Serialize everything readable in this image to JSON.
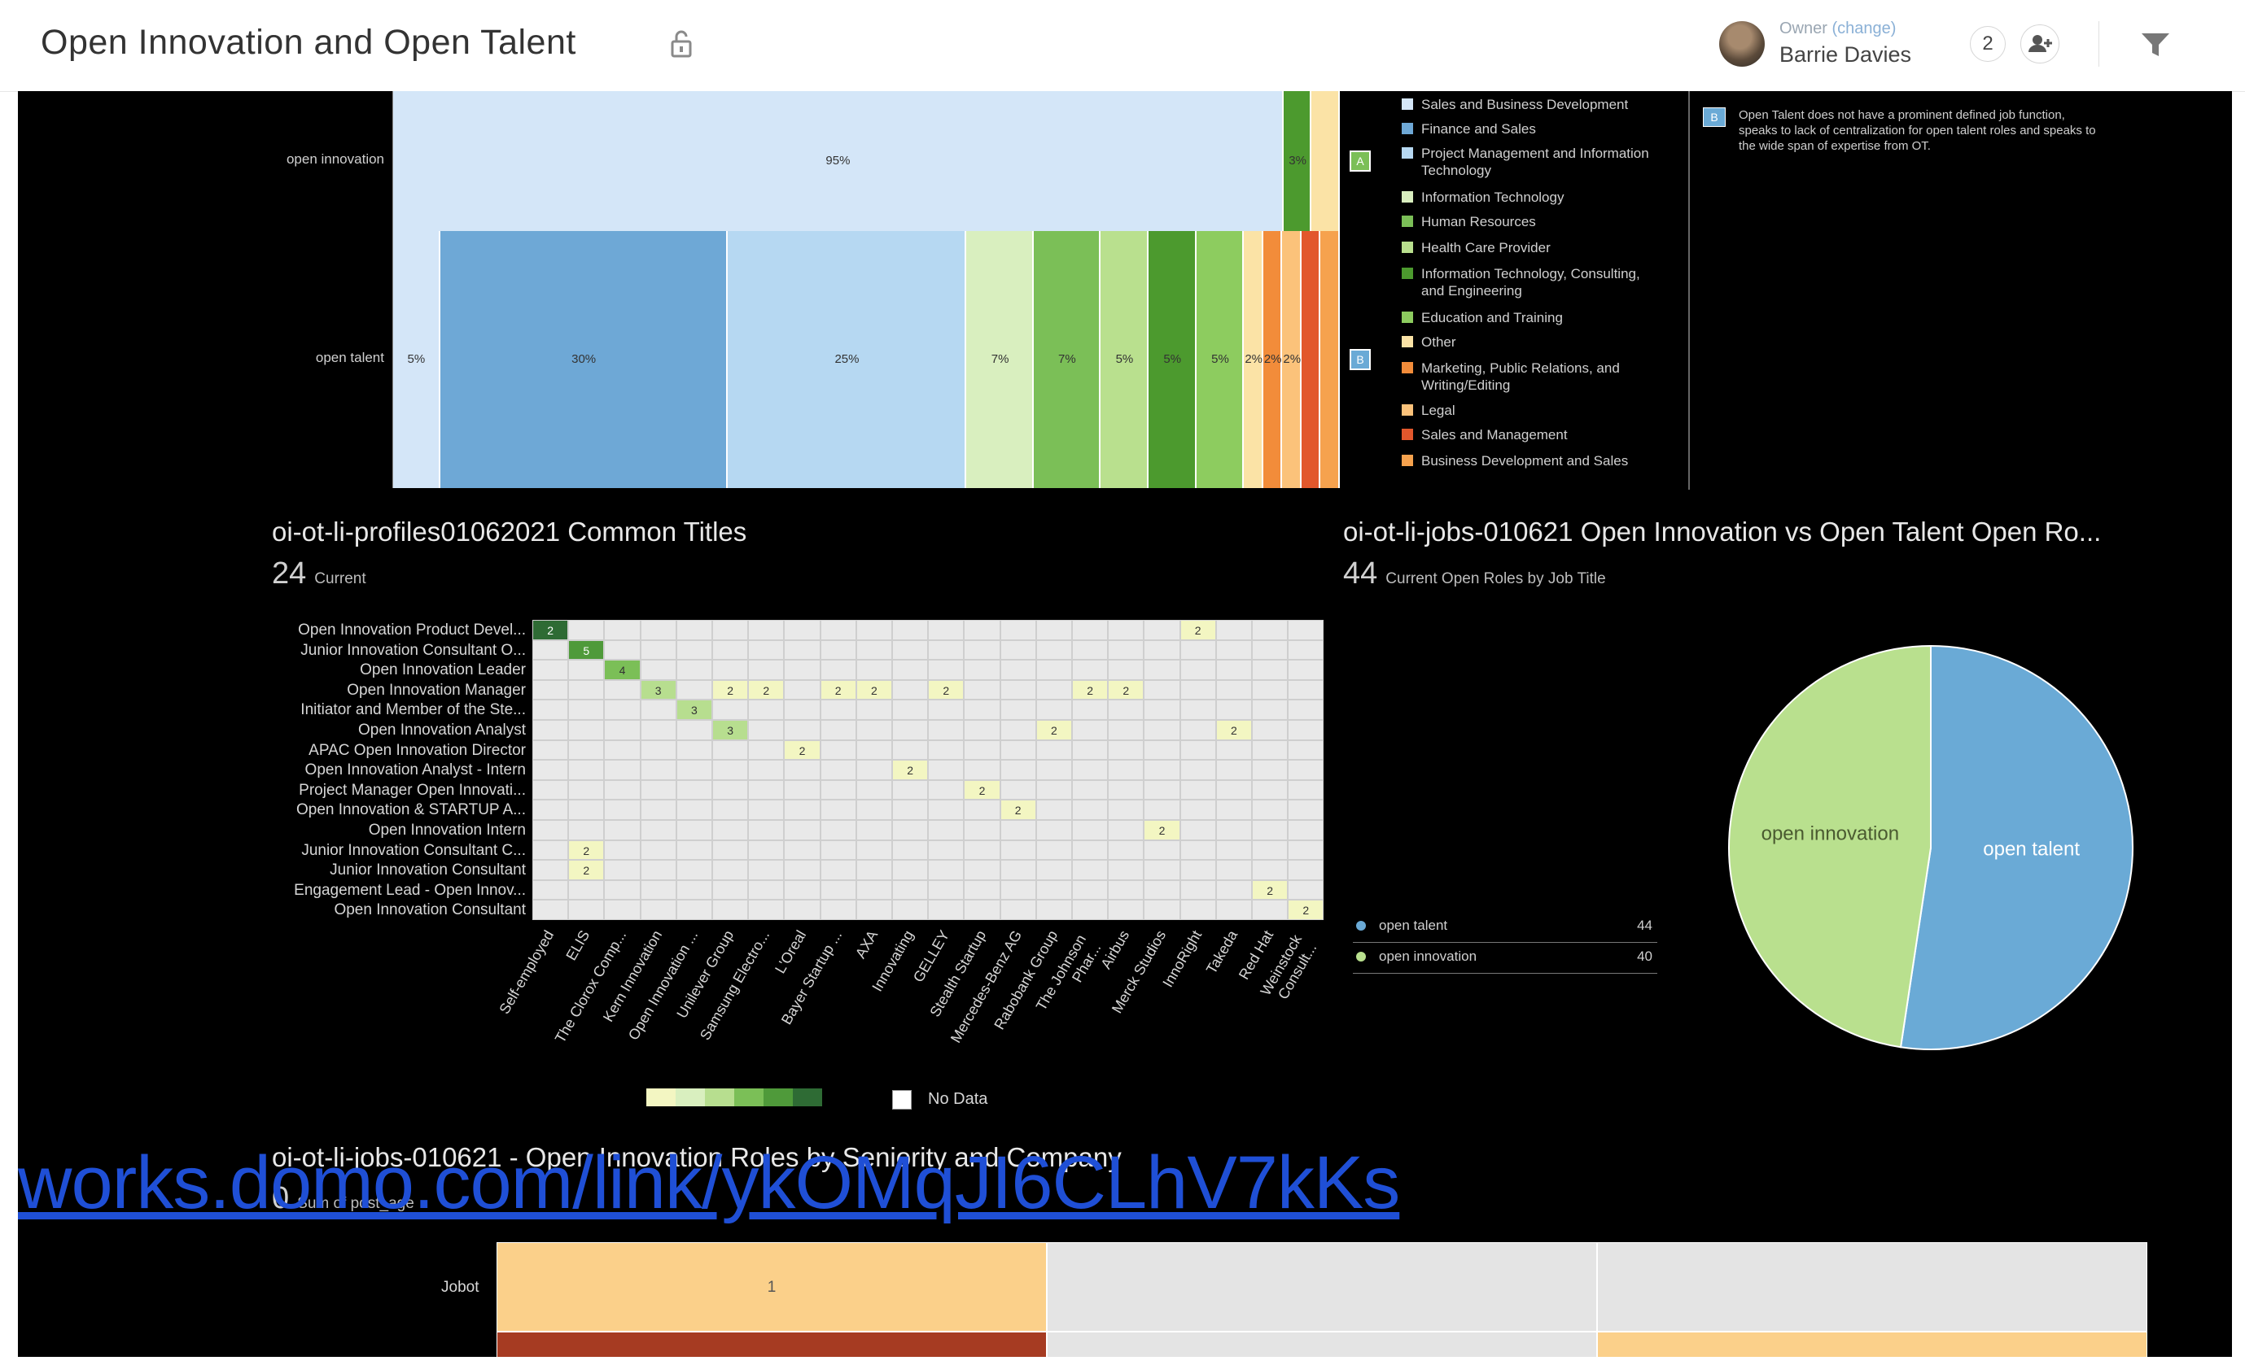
{
  "header": {
    "title": "Open Innovation and Open Talent",
    "owner_label": "Owner",
    "owner_change": "(change)",
    "owner_name": "Barrie Davies",
    "share_count": "2",
    "icons": [
      "lock-icon",
      "add-user-icon",
      "filter-icon"
    ]
  },
  "stacked_bar": {
    "rows": [
      {
        "label": "open innovation",
        "marker": "A"
      },
      {
        "label": "open talent",
        "marker": "B"
      }
    ],
    "legend": [
      {
        "label": "Sales and Business Development",
        "color": "#d4e6f8"
      },
      {
        "label": "Finance and Sales",
        "color": "#6ea8d6"
      },
      {
        "label": "Project Management and Information Technology",
        "color": "#b6d8f2"
      },
      {
        "label": "Information Technology",
        "color": "#d9efbf"
      },
      {
        "label": "Human Resources",
        "color": "#7bbf57"
      },
      {
        "label": "Health Care Provider",
        "color": "#b9e08e"
      },
      {
        "label": "Information Technology, Consulting, and Engineering",
        "color": "#4c9a2e"
      },
      {
        "label": "Education and Training",
        "color": "#8dcc5f"
      },
      {
        "label": "Other",
        "color": "#fbe3a6"
      },
      {
        "label": "Marketing, Public Relations, and Writing/Editing",
        "color": "#f28c3a"
      },
      {
        "label": "Legal",
        "color": "#fbc27a"
      },
      {
        "label": "Sales and Management",
        "color": "#e2572c"
      },
      {
        "label": "Business Development and Sales",
        "color": "#f6a24e"
      }
    ],
    "note": "Open Talent does not have a prominent defined job function, speaks to lack of centralization for open talent roles and speaks to the wide span of expertise from OT.",
    "note_marker": "B"
  },
  "heatmap": {
    "title": "oi-ot-li-profiles01062021 Common Titles",
    "summary_value": "24",
    "summary_label": "Current",
    "rows": [
      "Open Innovation Product Devel...",
      "Junior Innovation Consultant O...",
      "Open Innovation Leader",
      "Open Innovation Manager",
      "Initiator and Member of the Ste...",
      "Open Innovation Analyst",
      "APAC Open Innovation Director",
      "Open Innovation Analyst - Intern",
      "Project Manager Open Innovati...",
      "Open Innovation & STARTUP A...",
      "Open Innovation Intern",
      "Junior Innovation Consultant C...",
      "Junior Innovation Consultant",
      "Engagement Lead - Open Innov...",
      "Open Innovation Consultant"
    ],
    "columns": [
      "Self-employed",
      "ELIS",
      "The Clorox Comp...",
      "Kern Innovation",
      "Open Innovation ...",
      "Unilever Group",
      "Samsung Electro...",
      "L'Oreal",
      "Bayer Startup ...",
      "AXA",
      "Innovating",
      "GELLEY",
      "Stealth Startup",
      "Mercedes-Benz AG",
      "Rabobank Group",
      "The Johnson Phar...",
      "Airbus",
      "Merck Studios",
      "InnoRight",
      "Takeda",
      "Red Hat",
      "Weinstock Consult..."
    ],
    "cells": [
      {
        "r": 0,
        "c": 0,
        "v": "2",
        "color": "#2e6b34"
      },
      {
        "r": 0,
        "c": 18,
        "v": "2",
        "color": "#f3f6c2"
      },
      {
        "r": 1,
        "c": 1,
        "v": "5",
        "color": "#4f9a3a"
      },
      {
        "r": 2,
        "c": 2,
        "v": "4",
        "color": "#7bbf57"
      },
      {
        "r": 3,
        "c": 3,
        "v": "3",
        "color": "#b7de8f"
      },
      {
        "r": 3,
        "c": 5,
        "v": "2",
        "color": "#f3f6c2"
      },
      {
        "r": 3,
        "c": 6,
        "v": "2",
        "color": "#f3f6c2"
      },
      {
        "r": 3,
        "c": 8,
        "v": "2",
        "color": "#f3f6c2"
      },
      {
        "r": 3,
        "c": 9,
        "v": "2",
        "color": "#f3f6c2"
      },
      {
        "r": 3,
        "c": 11,
        "v": "2",
        "color": "#f3f6c2"
      },
      {
        "r": 3,
        "c": 15,
        "v": "2",
        "color": "#f3f6c2"
      },
      {
        "r": 3,
        "c": 16,
        "v": "2",
        "color": "#f3f6c2"
      },
      {
        "r": 4,
        "c": 4,
        "v": "3",
        "color": "#b7de8f"
      },
      {
        "r": 5,
        "c": 5,
        "v": "3",
        "color": "#b7de8f"
      },
      {
        "r": 5,
        "c": 14,
        "v": "2",
        "color": "#f3f6c2"
      },
      {
        "r": 5,
        "c": 19,
        "v": "2",
        "color": "#f3f6c2"
      },
      {
        "r": 6,
        "c": 7,
        "v": "2",
        "color": "#f3f6c2"
      },
      {
        "r": 7,
        "c": 10,
        "v": "2",
        "color": "#f3f6c2"
      },
      {
        "r": 8,
        "c": 12,
        "v": "2",
        "color": "#f3f6c2"
      },
      {
        "r": 9,
        "c": 13,
        "v": "2",
        "color": "#f3f6c2"
      },
      {
        "r": 10,
        "c": 17,
        "v": "2",
        "color": "#f3f6c2"
      },
      {
        "r": 11,
        "c": 1,
        "v": "2",
        "color": "#f3f6c2"
      },
      {
        "r": 12,
        "c": 1,
        "v": "2",
        "color": "#f3f6c2"
      },
      {
        "r": 13,
        "c": 20,
        "v": "2",
        "color": "#f3f6c2"
      },
      {
        "r": 14,
        "c": 21,
        "v": "2",
        "color": "#f3f6c2"
      }
    ],
    "legend_no_data": "No Data"
  },
  "pie": {
    "title": "oi-ot-li-jobs-010621 Open Innovation vs Open Talent Open Ro...",
    "summary_value": "44",
    "summary_label": "Current Open Roles by Job Title",
    "slices": [
      {
        "label": "open talent",
        "value": 44,
        "color": "#6aaad6"
      },
      {
        "label": "open innovation",
        "value": 40,
        "color": "#b9e08e"
      }
    ]
  },
  "link_overlay": "works.domo.com/link/ykOMqJI6CLhV7kKs",
  "bottom_card": {
    "title": "oi-ot-li-jobs-010621 - Open Innovation Roles by Seniority and Company",
    "summary_value": "0",
    "summary_label": "Sum of post_age",
    "row_label": "Jobot",
    "cell_value": "1"
  },
  "chart_data": {
    "type": "bar",
    "categories": [
      "open innovation",
      "open talent"
    ],
    "series": [
      {
        "name": "Sales and Business Development",
        "values": [
          95,
          5
        ]
      },
      {
        "name": "Finance and Sales",
        "values": [
          0,
          30
        ]
      },
      {
        "name": "Project Management and Information Technology",
        "values": [
          0,
          25
        ]
      },
      {
        "name": "Information Technology",
        "values": [
          0,
          7
        ]
      },
      {
        "name": "Human Resources",
        "values": [
          0,
          7
        ]
      },
      {
        "name": "Health Care Provider",
        "values": [
          0,
          5
        ]
      },
      {
        "name": "Information Technology, Consulting, and Engineering",
        "values": [
          3,
          5
        ]
      },
      {
        "name": "Education and Training",
        "values": [
          0,
          5
        ]
      },
      {
        "name": "Other",
        "values": [
          3,
          2
        ]
      },
      {
        "name": "Marketing, Public Relations, and Writing/Editing",
        "values": [
          0,
          2
        ]
      },
      {
        "name": "Legal",
        "values": [
          0,
          2
        ]
      },
      {
        "name": "Sales and Management",
        "values": [
          0,
          2
        ]
      },
      {
        "name": "Business Development and Sales",
        "values": [
          0,
          2
        ]
      }
    ],
    "segment_labels": {
      "open innovation": [
        "95%",
        "3%"
      ],
      "open talent": [
        "5%",
        "30%",
        "25%",
        "7%",
        "7%",
        "5%",
        "5%",
        "5%",
        "2%",
        "2%",
        "2%"
      ]
    }
  }
}
